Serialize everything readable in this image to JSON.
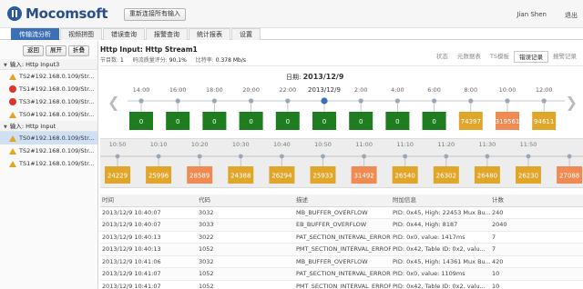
{
  "header": {
    "logo_text": "Mocomsoft",
    "reconnect_label": "重新连接所有输入",
    "user": "Jian Shen",
    "logout_label": "退出"
  },
  "tabs": [
    {
      "label": "传输流分析",
      "active": true
    },
    {
      "label": "视频拼图",
      "active": false
    },
    {
      "label": "错误查询",
      "active": false
    },
    {
      "label": "报警查询",
      "active": false
    },
    {
      "label": "统计报表",
      "active": false
    },
    {
      "label": "设置",
      "active": false
    }
  ],
  "sidebar": {
    "buttons": {
      "back": "返回",
      "expand": "展开",
      "collapse": "折叠"
    },
    "groups": [
      {
        "label": "输入: Http Input3",
        "items": [
          {
            "label": "TS2#192.168.0.109/Str...",
            "status": "warn"
          },
          {
            "label": "TS1#192.168.0.109/Str...",
            "status": "err"
          },
          {
            "label": "TS3#192.168.0.109/Str...",
            "status": "err"
          },
          {
            "label": "TS0#192.168.0.109/Str...",
            "status": "warn"
          }
        ]
      },
      {
        "label": "输入: Http Input",
        "items": [
          {
            "label": "TS0#192.168.0.109/Str...",
            "status": "warn",
            "selected": true
          },
          {
            "label": "TS2#192.168.0.109/Str...",
            "status": "warn"
          },
          {
            "label": "TS1#192.168.0.109/Str...",
            "status": "warn"
          }
        ]
      }
    ]
  },
  "main": {
    "title": "Http Input: Http Stream1",
    "stats": [
      {
        "label": "节目数:",
        "value": "1"
      },
      {
        "label": "码流质量评分:",
        "value": "90.1%"
      },
      {
        "label": "比特率:",
        "value": "0.378 Mb/s"
      }
    ],
    "view_tabs": [
      {
        "label": "状态",
        "active": false
      },
      {
        "label": "元数据表",
        "active": false
      },
      {
        "label": "TS模板",
        "active": false
      },
      {
        "label": "错误记录",
        "active": true
      },
      {
        "label": "报警记录",
        "active": false
      }
    ]
  },
  "day_timeline": {
    "date_prefix": "日期:",
    "date": "2013/12/9",
    "center_label": "2013/12/9",
    "hours": [
      "14:00",
      "16:00",
      "18:00",
      "20:00",
      "22:00",
      "",
      "2:00",
      "4:00",
      "6:00",
      "8:00",
      "10:00",
      "12:00"
    ],
    "counts": [
      "0",
      "0",
      "0",
      "0",
      "0",
      "0",
      "0",
      "0",
      "0",
      "74397",
      "319561",
      "94611"
    ],
    "levels": [
      "ok",
      "ok",
      "ok",
      "ok",
      "ok",
      "ok",
      "ok",
      "ok",
      "ok",
      "warn",
      "err",
      "warn"
    ]
  },
  "minute_timeline": {
    "times": [
      "10:50",
      "10:10",
      "10:20",
      "10:30",
      "10:40",
      "10:50",
      "11:00",
      "11:10",
      "11:20",
      "11:30",
      "11:50"
    ],
    "counts": [
      "24229",
      "25996",
      "28589",
      "24388",
      "26294",
      "25933",
      "31492",
      "26540",
      "26302",
      "26480",
      "26230",
      "27088"
    ],
    "levels": [
      "warn",
      "warn",
      "err",
      "warn",
      "warn",
      "warn",
      "err",
      "warn",
      "warn",
      "warn",
      "warn",
      "err"
    ]
  },
  "colors": {
    "ok": "#1e7d1e",
    "warn": "#e0a62a",
    "err": "#ef8a52",
    "accent": "#3b6fb6"
  },
  "table": {
    "columns": [
      "时间",
      "代码",
      "描述",
      "附加信息",
      "计数"
    ],
    "rows": [
      [
        "2013/12/9 10:40:07",
        "3032",
        "MB_BUFFER_OVERFLOW",
        "PID: 0x45, High: 22453 Mux Bu...",
        "240"
      ],
      [
        "2013/12/9 10:40:07",
        "3033",
        "EB_BUFFER_OVERFLOW",
        "PID: 0x44, High: 8187",
        "2040"
      ],
      [
        "2013/12/9 10:40:13",
        "3022",
        "PAT_SECTION_INTERVAL_ERROR",
        "PID: 0x0, value: 1417ms",
        "7"
      ],
      [
        "2013/12/9 10:40:13",
        "1052",
        "PMT_SECTION_INTERVAL_ERROR",
        "PID: 0x42, Table ID: 0x2, valu...",
        "7"
      ],
      [
        "2013/12/9 10:41:06",
        "3032",
        "MB_BUFFER_OVERFLOW",
        "PID: 0x45, High: 14361 Mux Bu...",
        "420"
      ],
      [
        "2013/12/9 10:41:07",
        "1052",
        "PAT_SECTION_INTERVAL_ERROR",
        "PID: 0x0, value: 1109ms",
        "10"
      ],
      [
        "2013/12/9 10:41:07",
        "1052",
        "PMT_SECTION_INTERVAL_ERROR",
        "PID: 0x42, Table ID: 0x2, valu...",
        "10"
      ]
    ]
  }
}
